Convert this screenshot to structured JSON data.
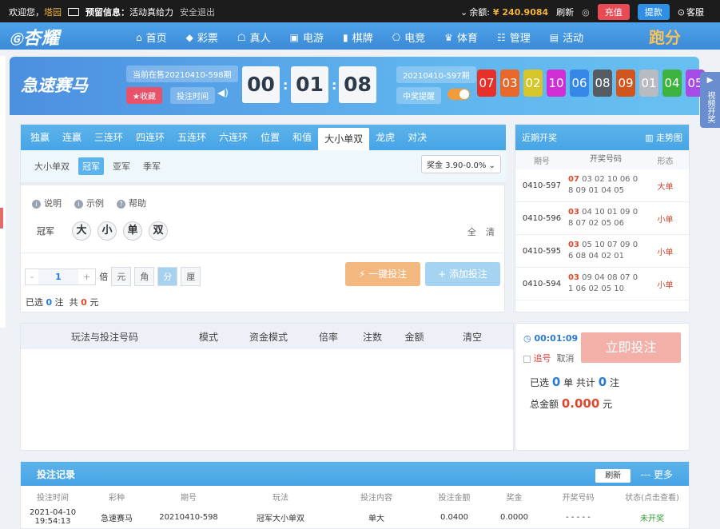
{
  "topbar": {
    "welcome": "欢迎您，",
    "username": "塔园",
    "notice_title": "预留信息：",
    "notice": "活动真给力",
    "logout": "安全退出",
    "balance_label": "余额:",
    "balance": "¥ 240.9084",
    "refresh": "刷新",
    "deposit": "充值",
    "withdraw": "提款",
    "service": "客服"
  },
  "nav": {
    "logo": "杏耀",
    "items": [
      "首页",
      "彩票",
      "真人",
      "电游",
      "棋牌",
      "电竞",
      "体育",
      "管理",
      "活动"
    ],
    "extra": "跑分"
  },
  "hero": {
    "game_name": "急速赛马",
    "current_label": "当前在售20210410-598期",
    "favorite": "★收藏",
    "bet_time": "投注时间",
    "countdown": [
      "00",
      "01",
      "08"
    ],
    "last_period": "20210410-597期",
    "win_alert": "中奖提醒",
    "balls": [
      "07",
      "03",
      "02",
      "10",
      "06",
      "08",
      "09",
      "01",
      "04",
      "05"
    ],
    "ball_colors": [
      "#e8302b",
      "#e8682b",
      "#d6c62a",
      "#d02fd8",
      "#3489e8",
      "#555c63",
      "#d2551e",
      "#b8bcc2",
      "#3cb33c",
      "#a74be6"
    ],
    "video_tab": "视频开奖"
  },
  "tabs": {
    "items": [
      "独赢",
      "连赢",
      "三连环",
      "四连环",
      "五连环",
      "六连环",
      "位置",
      "和值",
      "大小单双",
      "龙虎",
      "对决"
    ],
    "active_index": 8
  },
  "subtabs": {
    "items": [
      "大小单双",
      "冠军",
      "亚军",
      "季军"
    ],
    "active_index": 1
  },
  "prize": "奖金 3.90-0.0%",
  "help": {
    "explain": "说明",
    "example": "示例",
    "help": "帮助"
  },
  "pick": {
    "label": "冠军",
    "numbers": [
      "大",
      "小",
      "单",
      "双"
    ],
    "all": "全",
    "clear": "清"
  },
  "bet": {
    "minus": "-",
    "multiplier": "1",
    "plus": "+",
    "bei": "倍",
    "units": [
      "元",
      "角",
      "分",
      "厘"
    ],
    "unit_active": 2,
    "onekey": "⚡ 一键投注",
    "add": "+ 添加投注",
    "selected_a": "已选",
    "selected_count": "0",
    "selected_b": "注",
    "total_a": "共",
    "total_amount": "0",
    "total_b": "元"
  },
  "draws": {
    "title": "近期开奖",
    "trend": "走势图",
    "cols": [
      "期号",
      "开奖号码",
      "形态"
    ],
    "rows": [
      {
        "period": "0410-597",
        "first": "07",
        "rest": "03 02 10 06 0 8 09 01 04 05",
        "shape": "大单"
      },
      {
        "period": "0410-596",
        "first": "03",
        "rest": "04 10 01 09 0 8 07 02 05 06",
        "shape": "小单"
      },
      {
        "period": "0410-595",
        "first": "03",
        "rest": "05 10 07 09 0 6 08 04 02 01",
        "shape": "小单"
      },
      {
        "period": "0410-594",
        "first": "03",
        "rest": "09 04 08 07 0 1 06 02 05 10",
        "shape": "小单"
      }
    ]
  },
  "orders": {
    "cols": [
      "玩法与投注号码",
      "模式",
      "资金模式",
      "倍率",
      "注数",
      "金额",
      "清空"
    ]
  },
  "betside": {
    "timer": "00:01:09",
    "chase": "追号",
    "cancel": "取消",
    "bet_now": "立即投注",
    "sel_a": "已选",
    "sel_count": "0",
    "sel_b": "单 共计",
    "sel_notes": "0",
    "sel_c": "注",
    "total_label": "总金额",
    "total": "0.000",
    "total_unit": "元"
  },
  "records": {
    "title": "投注记录",
    "refresh": "刷新",
    "more": "--- 更多",
    "cols": [
      "投注时间",
      "彩种",
      "期号",
      "玩法",
      "投注内容",
      "投注金额",
      "奖金",
      "开奖号码",
      "状态(点击查看)"
    ],
    "row": [
      "2021-04-10 19:54:13",
      "急速赛马",
      "20210410-598",
      "冠军大小单双",
      "单大",
      "0.0400",
      "0.0000",
      "- - - - -",
      "未开奖"
    ]
  }
}
